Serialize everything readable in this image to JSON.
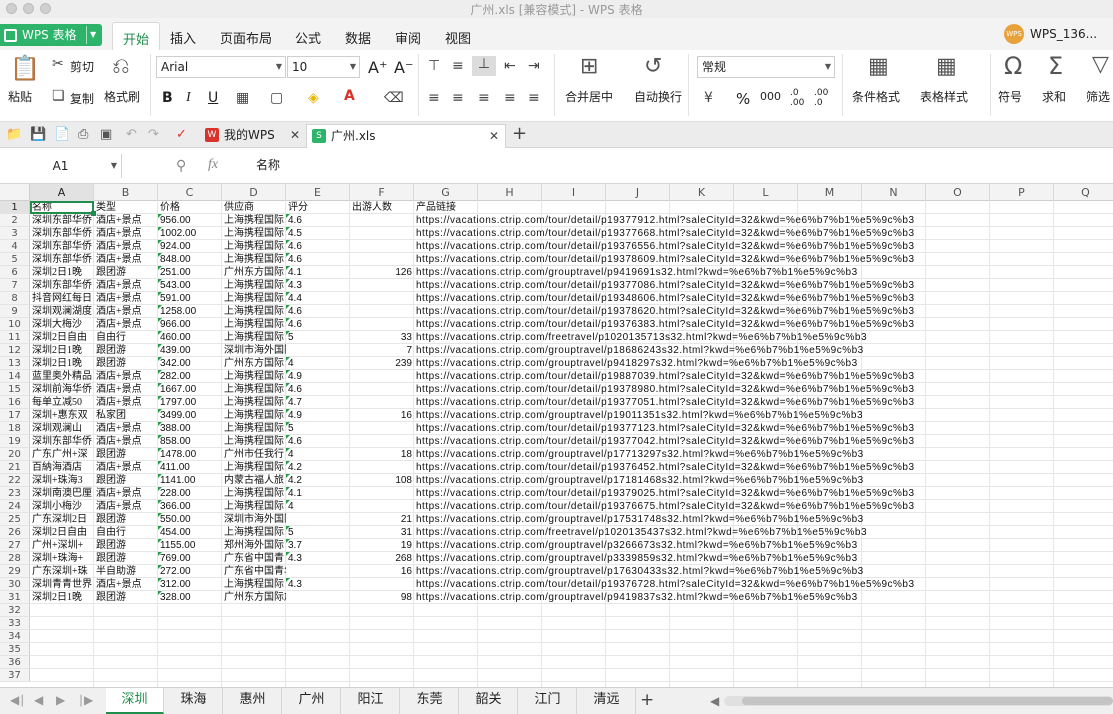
{
  "window": {
    "title": "广州.xls [兼容模式] - WPS 表格"
  },
  "menubar": {
    "app_label": "WPS 表格",
    "tabs": [
      "开始",
      "插入",
      "页面布局",
      "公式",
      "数据",
      "审阅",
      "视图"
    ],
    "user": "WPS_136..."
  },
  "ribbon": {
    "paste": "粘贴",
    "cut": "剪切",
    "copy": "复制",
    "format_painter": "格式刷",
    "font_name": "Arial",
    "font_size": "10",
    "bold": "B",
    "italic": "I",
    "underline": "U",
    "merge_center": "合并居中",
    "wrap_text": "自动换行",
    "number_format": "常规",
    "percent": "%",
    "conditional_format": "条件格式",
    "table_style": "表格样式",
    "symbol": "符号",
    "sum": "求和",
    "filter": "筛选"
  },
  "tabbar": {
    "tabs": [
      {
        "label": "我的WPS",
        "color": "#d9342b"
      },
      {
        "label": "广州.xls",
        "color": "#2eb36a"
      }
    ]
  },
  "formula_bar": {
    "cell_ref": "A1",
    "fx": "fx",
    "content": "名称"
  },
  "grid": {
    "columns": [
      "A",
      "B",
      "C",
      "D",
      "E",
      "F",
      "G",
      "H",
      "I",
      "J",
      "K",
      "L",
      "M",
      "N",
      "O",
      "P",
      "Q"
    ],
    "row_numbers": [
      "1",
      "2",
      "3",
      "4",
      "5",
      "6",
      "7",
      "8",
      "9",
      "10",
      "11",
      "12",
      "13",
      "14",
      "15",
      "16",
      "17",
      "18",
      "19",
      "20",
      "21",
      "22",
      "23",
      "24",
      "25",
      "26",
      "27",
      "28",
      "29",
      "30",
      "31",
      "32",
      "33",
      "34",
      "35",
      "36",
      "37"
    ],
    "header": [
      "名称",
      "类型",
      "价格",
      "供应商",
      "评分",
      "出游人数",
      "产品链接"
    ],
    "rows": [
      [
        "深圳东部华侨",
        "酒店+景点",
        "956.00",
        "上海携程国际",
        "4.6",
        "",
        "https://vacations.ctrip.com/tour/detail/p19377912.html?saleCityId=32&kwd=%e6%b7%b1%e5%9c%b3"
      ],
      [
        "深圳东部华侨",
        "酒店+景点",
        "1002.00",
        "上海携程国际",
        "4.5",
        "",
        "https://vacations.ctrip.com/tour/detail/p19377668.html?saleCityId=32&kwd=%e6%b7%b1%e5%9c%b3"
      ],
      [
        "深圳东部华侨",
        "酒店+景点",
        "924.00",
        "上海携程国际",
        "4.6",
        "",
        "https://vacations.ctrip.com/tour/detail/p19376556.html?saleCityId=32&kwd=%e6%b7%b1%e5%9c%b3"
      ],
      [
        "深圳东部华侨",
        "酒店+景点",
        "848.00",
        "上海携程国际",
        "4.6",
        "",
        "https://vacations.ctrip.com/tour/detail/p19378609.html?saleCityId=32&kwd=%e6%b7%b1%e5%9c%b3"
      ],
      [
        "深圳2日1晚",
        "跟团游",
        "251.00",
        "广州东方国际",
        "4.1",
        "126",
        "https://vacations.ctrip.com/grouptravel/p9419691s32.html?kwd=%e6%b7%b1%e5%9c%b3"
      ],
      [
        "深圳东部华侨",
        "酒店+景点",
        "543.00",
        "上海携程国际",
        "4.3",
        "",
        "https://vacations.ctrip.com/tour/detail/p19377086.html?saleCityId=32&kwd=%e6%b7%b1%e5%9c%b3"
      ],
      [
        "抖音网红每日",
        "酒店+景点",
        "591.00",
        "上海携程国际",
        "4.4",
        "",
        "https://vacations.ctrip.com/tour/detail/p19348606.html?saleCityId=32&kwd=%e6%b7%b1%e5%9c%b3"
      ],
      [
        "深圳观澜湖度",
        "酒店+景点",
        "1258.00",
        "上海携程国际",
        "4.6",
        "",
        "https://vacations.ctrip.com/tour/detail/p19378620.html?saleCityId=32&kwd=%e6%b7%b1%e5%9c%b3"
      ],
      [
        "深圳大梅沙",
        "酒店+景点",
        "966.00",
        "上海携程国际",
        "4.6",
        "",
        "https://vacations.ctrip.com/tour/detail/p19376383.html?saleCityId=32&kwd=%e6%b7%b1%e5%9c%b3"
      ],
      [
        "深圳2日自由",
        "自由行",
        "460.00",
        "上海携程国际",
        "5",
        "33",
        "https://vacations.ctrip.com/freetravel/p1020135713s32.html?kwd=%e6%b7%b1%e5%9c%b3"
      ],
      [
        "深圳2日1晚",
        "跟团游",
        "439.00",
        "深圳市海外国际旅行社有限公",
        "",
        "7",
        "https://vacations.ctrip.com/grouptravel/p18686243s32.html?kwd=%e6%b7%b1%e5%9c%b3"
      ],
      [
        "深圳2日1晚",
        "跟团游",
        "342.00",
        "广州东方国际",
        "4",
        "239",
        "https://vacations.ctrip.com/grouptravel/p9418297s32.html?kwd=%e6%b7%b1%e5%9c%b3"
      ],
      [
        "蓝里奥外精品",
        "酒店+景点",
        "282.00",
        "上海携程国际",
        "4.9",
        "",
        "https://vacations.ctrip.com/tour/detail/p19887039.html?saleCityId=32&kwd=%e6%b7%b1%e5%9c%b3"
      ],
      [
        "深圳前海华侨",
        "酒店+景点",
        "1667.00",
        "上海携程国际",
        "4.6",
        "",
        "https://vacations.ctrip.com/tour/detail/p19378980.html?saleCityId=32&kwd=%e6%b7%b1%e5%9c%b3"
      ],
      [
        "每单立减50",
        "酒店+景点",
        "1797.00",
        "上海携程国际",
        "4.7",
        "",
        "https://vacations.ctrip.com/tour/detail/p19377051.html?saleCityId=32&kwd=%e6%b7%b1%e5%9c%b3"
      ],
      [
        "深圳+惠东双",
        "私家团",
        "3499.00",
        "上海携程国际",
        "4.9",
        "16",
        "https://vacations.ctrip.com/grouptravel/p19011351s32.html?kwd=%e6%b7%b1%e5%9c%b3"
      ],
      [
        "深圳观澜山",
        "酒店+景点",
        "388.00",
        "上海携程国际",
        "5",
        "",
        "https://vacations.ctrip.com/tour/detail/p19377123.html?saleCityId=32&kwd=%e6%b7%b1%e5%9c%b3"
      ],
      [
        "深圳东部华侨",
        "酒店+景点",
        "858.00",
        "上海携程国际",
        "4.6",
        "",
        "https://vacations.ctrip.com/tour/detail/p19377042.html?saleCityId=32&kwd=%e6%b7%b1%e5%9c%b3"
      ],
      [
        "广东广州+深",
        "跟团游",
        "1478.00",
        "广州市任我行",
        "4",
        "18",
        "https://vacations.ctrip.com/grouptravel/p17713297s32.html?kwd=%e6%b7%b1%e5%9c%b3"
      ],
      [
        "百納海酒店",
        "酒店+景点",
        "411.00",
        "上海携程国际",
        "4.2",
        "",
        "https://vacations.ctrip.com/tour/detail/p19376452.html?saleCityId=32&kwd=%e6%b7%b1%e5%9c%b3"
      ],
      [
        "深圳+珠海3",
        "跟团游",
        "1141.00",
        "内蒙古福人旅",
        "4.2",
        "108",
        "https://vacations.ctrip.com/grouptravel/p17181468s32.html?kwd=%e6%b7%b1%e5%9c%b3"
      ],
      [
        "深圳南澳巴厘",
        "酒店+景点",
        "228.00",
        "上海携程国际",
        "4.1",
        "",
        "https://vacations.ctrip.com/tour/detail/p19379025.html?saleCityId=32&kwd=%e6%b7%b1%e5%9c%b3"
      ],
      [
        "深圳小梅沙",
        "酒店+景点",
        "366.00",
        "上海携程国际",
        "4",
        "",
        "https://vacations.ctrip.com/tour/detail/p19376675.html?saleCityId=32&kwd=%e6%b7%b1%e5%9c%b3"
      ],
      [
        "广东深圳2日",
        "跟团游",
        "550.00",
        "深圳市海外国际旅行社有限公",
        "",
        "21",
        "https://vacations.ctrip.com/grouptravel/p17531748s32.html?kwd=%e6%b7%b1%e5%9c%b3"
      ],
      [
        "深圳2日自由",
        "自由行",
        "454.00",
        "上海携程国际",
        "5",
        "31",
        "https://vacations.ctrip.com/freetravel/p1020135437s32.html?kwd=%e6%b7%b1%e5%9c%b3"
      ],
      [
        "广州+深圳+",
        "跟团游",
        "1155.00",
        "郑州海外国际",
        "3.7",
        "19",
        "https://vacations.ctrip.com/grouptravel/p3266673s32.html?kwd=%e6%b7%b1%e5%9c%b3"
      ],
      [
        "深圳+珠海+",
        "跟团游",
        "769.00",
        "广东省中国青",
        "4.3",
        "268",
        "https://vacations.ctrip.com/grouptravel/p3339859s32.html?kwd=%e6%b7%b1%e5%9c%b3"
      ],
      [
        "广东深圳+珠",
        "半自助游",
        "272.00",
        "广东省中国青年旅行社华盛",
        "",
        "16",
        "https://vacations.ctrip.com/grouptravel/p17630433s32.html?kwd=%e6%b7%b1%e5%9c%b3"
      ],
      [
        "深圳青青世界",
        "酒店+景点",
        "312.00",
        "上海携程国际",
        "4.3",
        "",
        "https://vacations.ctrip.com/tour/detail/p19376728.html?saleCityId=32&kwd=%e6%b7%b1%e5%9c%b3"
      ],
      [
        "深圳2日1晚",
        "跟团游",
        "328.00",
        "广州东方国际旅行社有限公司",
        "",
        "98",
        "https://vacations.ctrip.com/grouptravel/p9419837s32.html?kwd=%e6%b7%b1%e5%9c%b3"
      ]
    ]
  },
  "sheets": {
    "tabs": [
      "深圳",
      "珠海",
      "惠州",
      "广州",
      "阳江",
      "东莞",
      "韶关",
      "江门",
      "清远"
    ],
    "active": "深圳"
  },
  "colors": {
    "accent": "#1f8d4b",
    "app_green": "#2eb36a"
  }
}
